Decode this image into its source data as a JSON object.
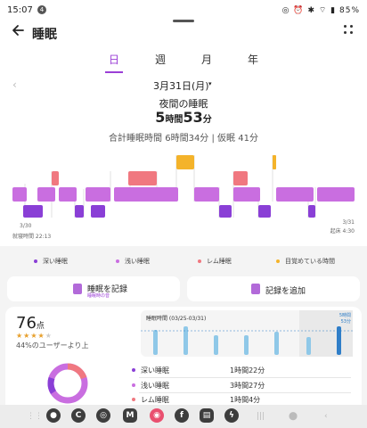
{
  "status": {
    "time": "15:07",
    "notif": "4",
    "battery": "85%",
    "right_icons": "◎ ⏰ ✱ ⌔ ▮ 85%"
  },
  "header": {
    "title": "睡眠",
    "back_icon": "arrow-left-icon",
    "more_icon": "more-icon"
  },
  "tabs": [
    {
      "label": "日",
      "active": true
    },
    {
      "label": "週",
      "active": false
    },
    {
      "label": "月",
      "active": false
    },
    {
      "label": "年",
      "active": false
    }
  ],
  "date": {
    "label": "3月31日(月)",
    "caret": "▾",
    "prev": "‹"
  },
  "night": {
    "label": "夜間の睡眠",
    "hours": "5",
    "hours_unit": "時間",
    "minutes": "53",
    "minutes_unit": "分",
    "total_line": "合計睡眠時間 6時間34分 | 仮眠 41分"
  },
  "hypnogram": {
    "start_date": "3/30",
    "start_time": "就寝時間 22:13",
    "end_date": "3/31",
    "end_time": "起床 4:30",
    "colors": {
      "awake": "#f4b32a",
      "rem": "#f07880",
      "light": "#c96ee0",
      "deep": "#8a3fd6"
    }
  },
  "legend": [
    {
      "label": "深い睡眠",
      "color": "#8a3fd6"
    },
    {
      "label": "浅い睡眠",
      "color": "#c96ee0"
    },
    {
      "label": "レム睡眠",
      "color": "#f07880"
    },
    {
      "label": "目覚めている時間",
      "color": "#f4b32a"
    }
  ],
  "actions": {
    "record_label": "睡眠を記録",
    "record_sub": "睡眠時の音",
    "add_label": "記録を追加"
  },
  "score": {
    "value": "76",
    "unit": "点",
    "stars_full": "★★★★",
    "stars_empty": "★",
    "rating": 4,
    "percent_text": "44%のユーザーより上"
  },
  "mini_chart": {
    "title": "睡眠時間 (03/25-03/31)",
    "avg_line1": "5時間",
    "avg_line2": "53分",
    "accent": "#2f7ec8"
  },
  "stages": [
    {
      "name": "深い睡眠",
      "time": "1時間22分",
      "color": "#8a3fd6"
    },
    {
      "name": "浅い睡眠",
      "time": "3時間27分",
      "color": "#c96ee0"
    },
    {
      "name": "レム睡眠",
      "time": "1時間4分",
      "color": "#f07880"
    }
  ],
  "dock": {
    "apps": [
      "chat-app-icon",
      "c-app-icon",
      "chrome-icon",
      "m-app-icon",
      "photos-icon",
      "facebook-icon",
      "news-icon",
      "messenger-icon"
    ]
  }
}
